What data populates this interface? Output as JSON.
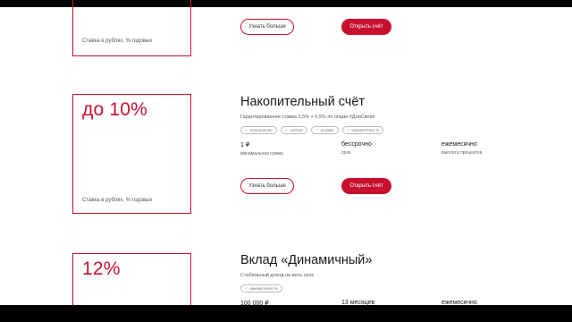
{
  "colors": {
    "accent": "#c8102e",
    "text": "#1a1a1a",
    "muted": "#666666"
  },
  "card_prev": {
    "rate_caption": "Ставка в рублях, % годовых",
    "more_label": "Узнать больше",
    "open_label": "Открыть счёт"
  },
  "card_savings": {
    "rate_value": "до 10%",
    "rate_caption": "Ставка в рублях, % годовых",
    "title": "Накопительный счёт",
    "subtitle": "Гарантированная ставка 3,5% + 6,5% по опции #ДляСвоих",
    "tags": [
      {
        "label": "пополнение",
        "icon": "check-icon"
      },
      {
        "label": "снятие",
        "icon": "check-icon"
      },
      {
        "label": "онлайн",
        "icon": "check-icon"
      },
      {
        "label": "ежемесячно %",
        "icon": "check-icon"
      }
    ],
    "facts": [
      {
        "value": "1 ₽",
        "label": "минимальная сумма"
      },
      {
        "value": "бессрочно",
        "label": "срок"
      },
      {
        "value": "ежемесячно",
        "label": "выплата процентов"
      }
    ],
    "more_label": "Узнать больше",
    "open_label": "Открыть счёт"
  },
  "card_deposit": {
    "rate_value": "12%",
    "title": "Вклад «Динамичный»",
    "subtitle": "Стабильный доход на весь срок",
    "tags": [
      {
        "label": "ежемесячно %",
        "icon": "check-icon"
      }
    ],
    "facts": [
      {
        "value": "100 000 ₽"
      },
      {
        "value": "13 месяцев"
      },
      {
        "value": "ежемесячно"
      }
    ]
  }
}
